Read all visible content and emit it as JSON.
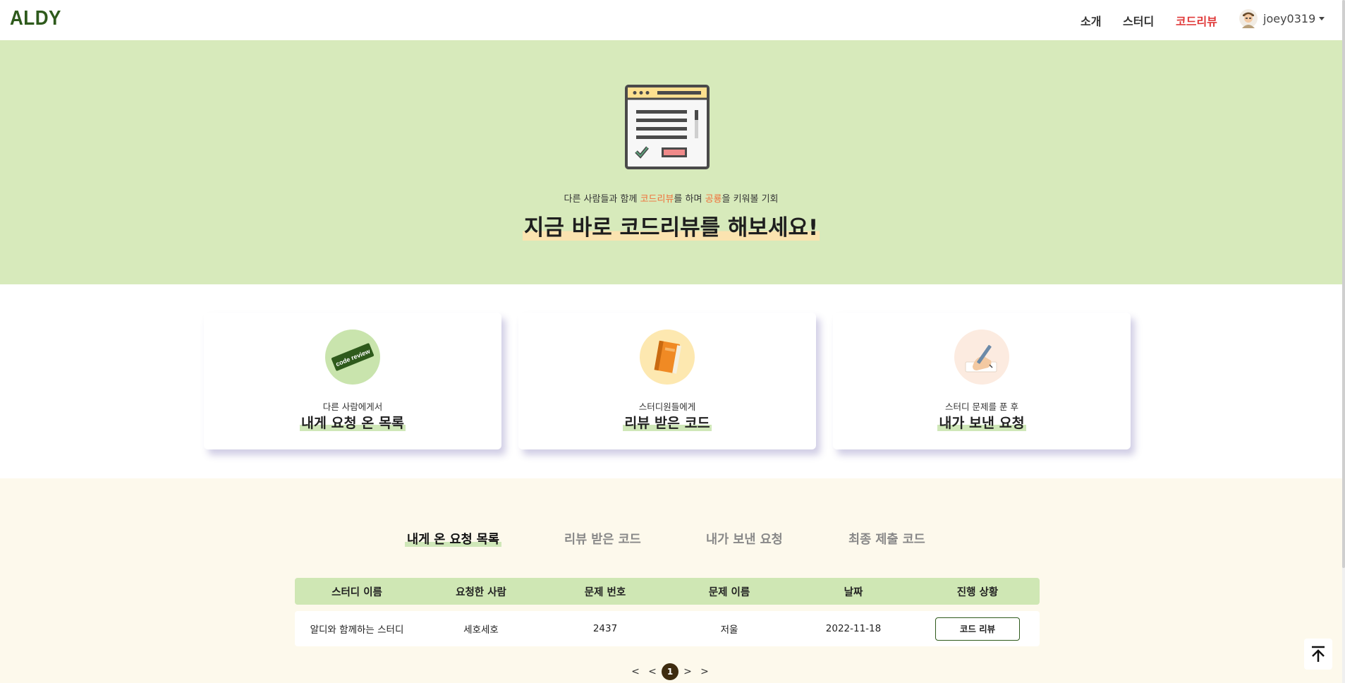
{
  "nav": {
    "logo": "ALDY",
    "links": [
      "소개",
      "스터디",
      "코드리뷰"
    ],
    "active_index": 2,
    "username": "joey0319",
    "active_color": "#e03a3a"
  },
  "hero": {
    "sub_before": "다른 사람들과 함께 ",
    "sub_hl1": "코드리뷰",
    "sub_mid": "를 하며 ",
    "sub_hl2": "공룡",
    "sub_after": "을 키워볼 기회",
    "title": "지금 바로 코드리뷰를 해보세요!",
    "bg_color": "#d7eabb",
    "icon": "browser-checklist-icon"
  },
  "cards": [
    {
      "sub": "다른 사람에게서",
      "title": "내게 요청 온 목록",
      "icon": "code-review-tag-icon",
      "badge_text": "code review"
    },
    {
      "sub": "스터디원들에게",
      "title": "리뷰 받은 코드",
      "icon": "book-icon"
    },
    {
      "sub": "스터디 문제를 푼 후",
      "title": "내가 보낸 요청",
      "icon": "writing-hand-icon"
    }
  ],
  "tabs": {
    "labels": [
      "내게 온 요청 목록",
      "리뷰 받은 코드",
      "내가 보낸 요청",
      "최종 제출 코드"
    ],
    "active_index": 0
  },
  "table": {
    "headers": [
      "스터디 이름",
      "요청한 사람",
      "문제 번호",
      "문제 이름",
      "날짜",
      "진행 상황"
    ],
    "rows": [
      {
        "study": "알디와 함께하는 스터디",
        "requester": "세호세호",
        "problem_no": "2437",
        "problem_name": "저울",
        "date": "2022-11-18",
        "action": "코드 리뷰"
      }
    ]
  },
  "pagination": {
    "first": "<",
    "prev": "<",
    "current": "1",
    "next": ">",
    "last": ">"
  },
  "scroll_top_icon": "arrow-up-to-top-icon"
}
